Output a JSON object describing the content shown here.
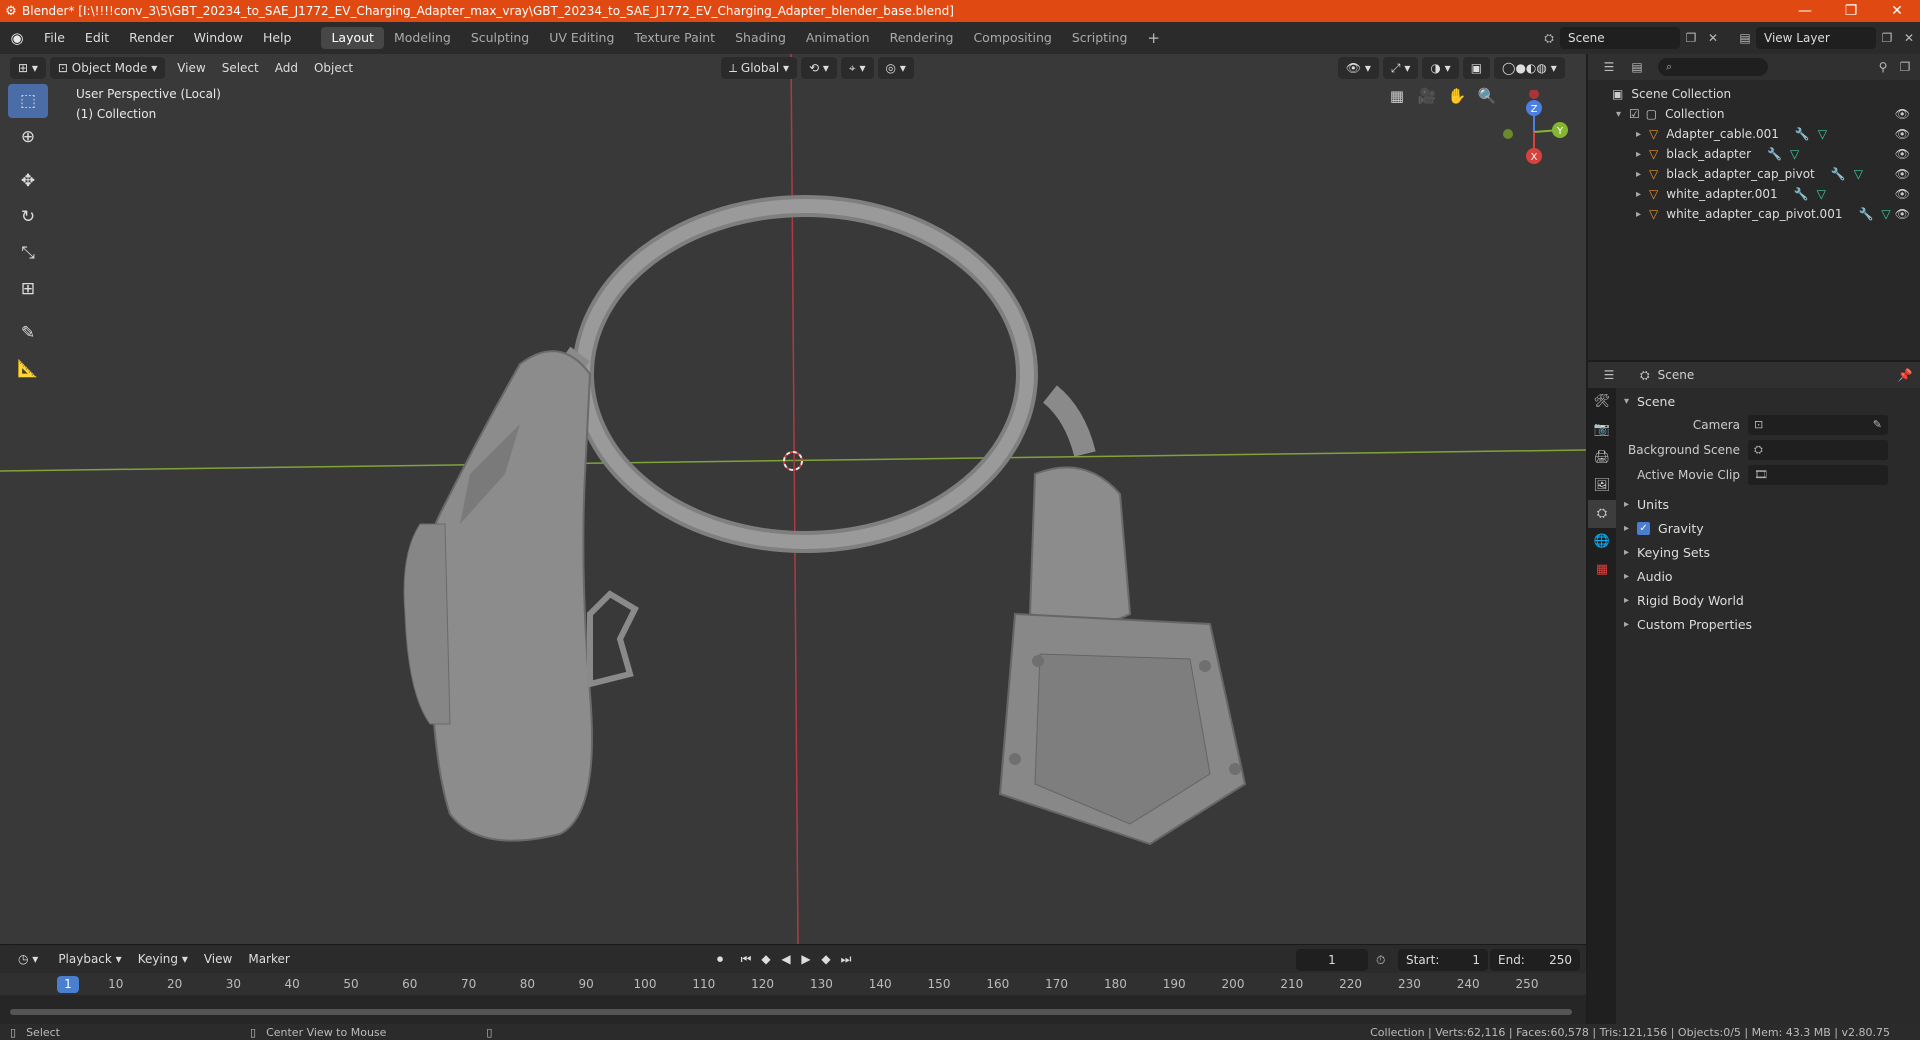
{
  "titlebar": {
    "title": "Blender* [I:\\!!!!conv_3\\5\\GBT_20234_to_SAE_J1772_EV_Charging_Adapter_max_vray\\GBT_20234_to_SAE_J1772_EV_Charging_Adapter_blender_base.blend]",
    "minimize": "—",
    "maximize": "❐",
    "close": "✕"
  },
  "menu": {
    "items": [
      "File",
      "Edit",
      "Render",
      "Window",
      "Help"
    ]
  },
  "workspaces": {
    "tabs": [
      "Layout",
      "Modeling",
      "Sculpting",
      "UV Editing",
      "Texture Paint",
      "Shading",
      "Animation",
      "Rendering",
      "Compositing",
      "Scripting"
    ],
    "active": "Layout",
    "add": "+"
  },
  "topright": {
    "scene": "Scene",
    "view_layer": "View Layer"
  },
  "viewport": {
    "mode": "Object Mode",
    "menus": [
      "View",
      "Select",
      "Add",
      "Object"
    ],
    "orientation": "Global",
    "overlay_line1": "User Perspective (Local)",
    "overlay_line2": "(1) Collection",
    "gizmo": {
      "z": "Z",
      "y": "Y",
      "x": "X"
    }
  },
  "timeline": {
    "menus": [
      "Playback",
      "Keying",
      "View",
      "Marker"
    ],
    "current_frame": "1",
    "start_label": "Start:",
    "start": "1",
    "end_label": "End:",
    "end": "250",
    "ticks": [
      "1",
      "10",
      "20",
      "30",
      "40",
      "50",
      "60",
      "70",
      "80",
      "90",
      "100",
      "110",
      "120",
      "130",
      "140",
      "150",
      "160",
      "170",
      "180",
      "190",
      "200",
      "210",
      "220",
      "230",
      "240",
      "250"
    ]
  },
  "statusbar": {
    "select": "Select",
    "center_view": "Center View to Mouse",
    "stats": "Collection | Verts:62,116 | Faces:60,578 | Tris:121,156 | Objects:0/5 | Mem: 43.3 MB | v2.80.75"
  },
  "outliner": {
    "scene_collection": "Scene Collection",
    "collection": "Collection",
    "objects": [
      "Adapter_cable.001",
      "black_adapter",
      "black_adapter_cap_pivot",
      "white_adapter.001",
      "white_adapter_cap_pivot.001"
    ]
  },
  "properties": {
    "header": "Scene",
    "section": "Scene",
    "camera_label": "Camera",
    "background_label": "Background Scene",
    "movie_clip_label": "Active Movie Clip",
    "panels": [
      "Units",
      "Gravity",
      "Keying Sets",
      "Audio",
      "Rigid Body World",
      "Custom Properties"
    ]
  },
  "colors": {
    "titlebar": "#e04a12",
    "accent": "#4a7fd0",
    "viewport_bg": "#393939",
    "model": "#8c8c8c"
  }
}
